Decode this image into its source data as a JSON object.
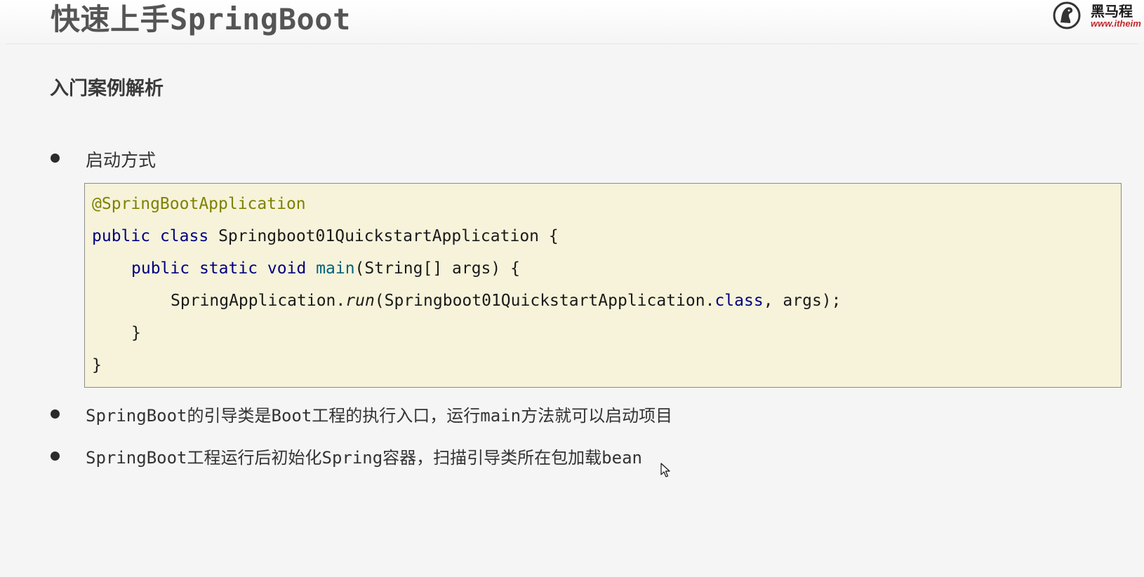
{
  "slide": {
    "title": "快速上手SpringBoot",
    "logo": {
      "name": "黑马程",
      "url": "www.itheim"
    },
    "section_heading": "入门案例解析",
    "bullets": [
      "启动方式",
      "SpringBoot的引导类是Boot工程的执行入口，运行main方法就可以启动项目",
      "SpringBoot工程运行后初始化Spring容器，扫描引导类所在包加载bean"
    ],
    "code": {
      "line1_annotation": "@SpringBootApplication",
      "line2_kw1": "public",
      "line2_kw2": "class",
      "line2_rest": "Springboot01QuickstartApplication {",
      "line3_kw1": "public",
      "line3_kw2": "static",
      "line3_kw3": "void",
      "line3_method": "main",
      "line3_rest": "(String[] args) {",
      "line4_a": "SpringApplication.",
      "line4_run": "run",
      "line4_b": "(Springboot01QuickstartApplication.",
      "line4_kw": "class",
      "line4_c": ", args);",
      "line5": "}",
      "line6": "}"
    },
    "colors": {
      "code_background": "#f6f3da",
      "annotation": "#808000",
      "keyword": "#000080",
      "method_name": "#00627a"
    },
    "icons": {
      "logo": "horse-head-logo-icon",
      "cursor": "mouse-pointer-icon"
    }
  }
}
